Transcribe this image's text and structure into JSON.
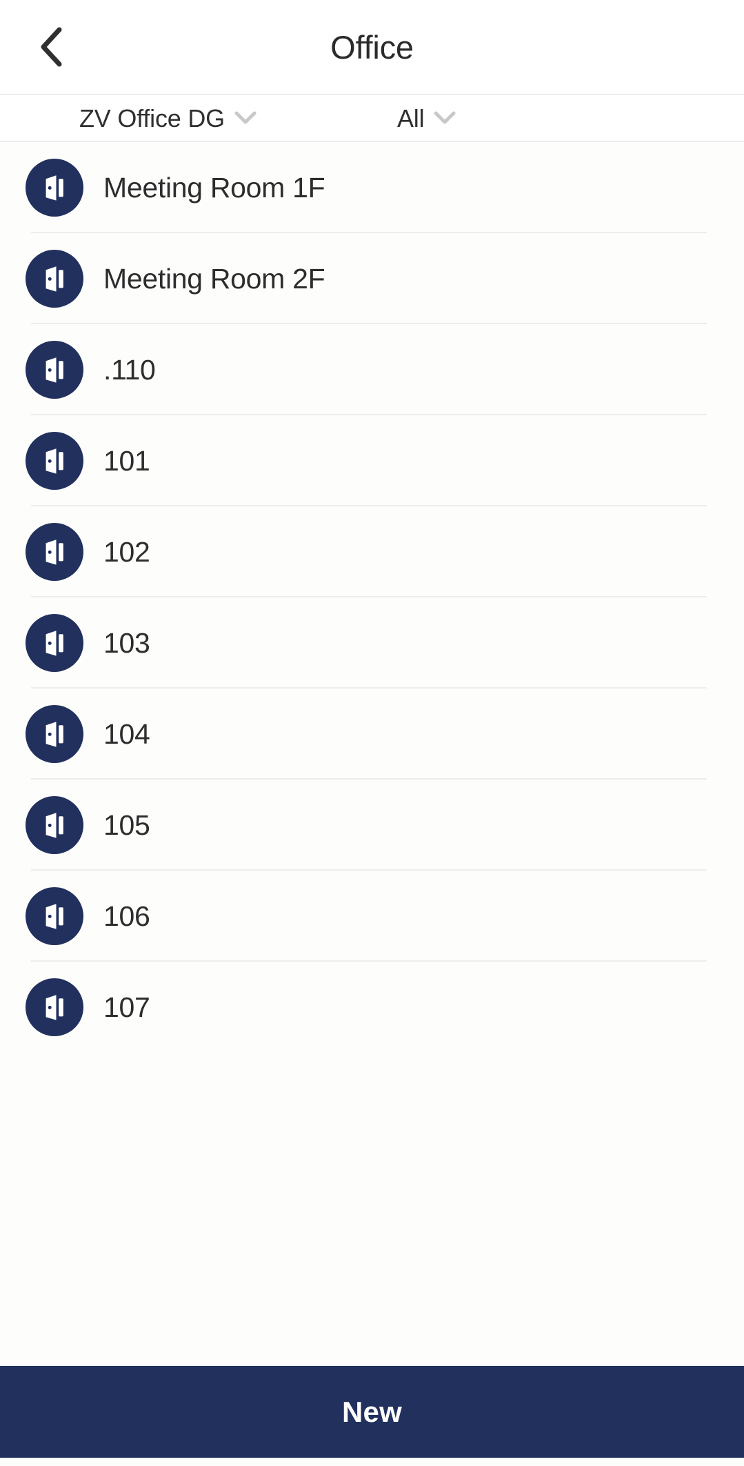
{
  "header": {
    "title": "Office",
    "back_icon": "chevron-left-icon"
  },
  "filters": [
    {
      "id": "group",
      "label": "ZV Office DG",
      "icon": "chevron-down-icon"
    },
    {
      "id": "scope",
      "label": "All",
      "icon": "chevron-down-icon"
    }
  ],
  "list": {
    "item_icon": "door-open-icon",
    "items": [
      {
        "label": "Meeting Room 1F"
      },
      {
        "label": "Meeting Room 2F"
      },
      {
        "label": ".110"
      },
      {
        "label": "101"
      },
      {
        "label": "102"
      },
      {
        "label": "103"
      },
      {
        "label": "104"
      },
      {
        "label": "105"
      },
      {
        "label": "106"
      },
      {
        "label": "107"
      }
    ]
  },
  "bottom_action": {
    "label": "New"
  },
  "colors": {
    "navy": "#22305E",
    "text": "#2D2D2D",
    "divider": "#EDEDED",
    "background": "#FDFDFC",
    "chevron_muted": "#C8C8C8"
  }
}
